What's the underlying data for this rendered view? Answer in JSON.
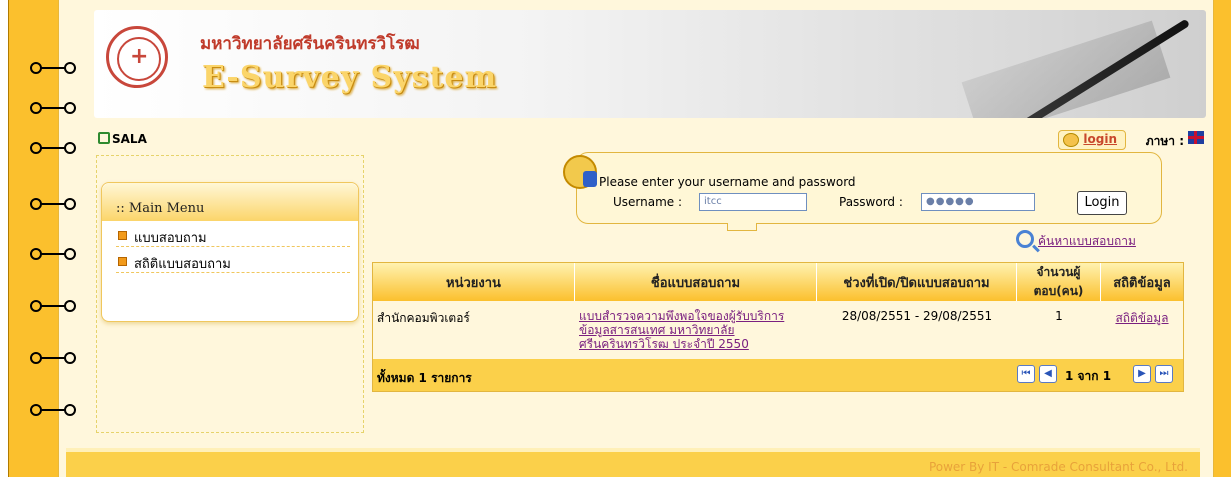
{
  "header": {
    "university_name": "มหาวิทยาลัยศรีนครินทรวิโรฒ",
    "system_name": "E-Survey System"
  },
  "topbar": {
    "site_label": "SALA",
    "login_link": "login",
    "language_label": "ภาษา :"
  },
  "sidebar": {
    "title": ":: Main Menu",
    "items": [
      {
        "label": "แบบสอบถาม"
      },
      {
        "label": "สถิติแบบสอบถาม"
      }
    ]
  },
  "login_popup": {
    "message": "Please enter your username and password",
    "username_label": "Username :",
    "username_value": "itcc",
    "password_label": "Password :",
    "password_value": "●●●●●",
    "login_button": "Login"
  },
  "search_link": "ค้นหาแบบสอบถาม",
  "table": {
    "headers": [
      "หน่วยงาน",
      "ชื่อแบบสอบถาม",
      "ช่วงที่เปิด/ปิดแบบสอบถาม",
      "จำนวนผู้ตอบ(คน)",
      "สถิติข้อมูล"
    ],
    "rows": [
      {
        "department": "สำนักคอมพิวเตอร์",
        "survey_name": "แบบสำรวจความพึงพอใจของผู้รับบริการข้อมูลสารสนเทศ มหาวิทยาลัยศรีนครินทรวิโรฒ ประจำปี 2550",
        "period": "28/08/2551 - 29/08/2551",
        "respondents": "1",
        "stats_link": "สถิติข้อมูล"
      }
    ],
    "total_label": "ทั้งหมด  1  รายการ",
    "pager": {
      "page_text": "1 จาก 1"
    }
  },
  "footer": {
    "text": "Power By IT - Comrade Consultant Co., Ltd."
  },
  "colors": {
    "frame": "#fbc02d",
    "page_bg": "#fff7dc",
    "link": "#7a2080",
    "table_header": "#fbc02d"
  }
}
